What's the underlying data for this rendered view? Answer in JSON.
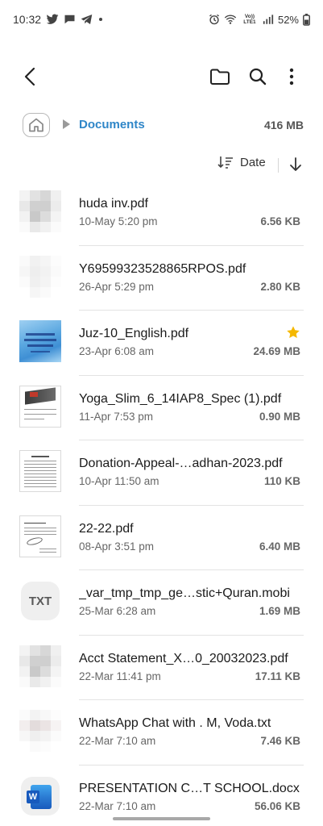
{
  "status_bar": {
    "time": "10:32",
    "net_label": "Vo)) LTE1",
    "battery": "52%"
  },
  "path": {
    "folder": "Documents",
    "storage": "416 MB"
  },
  "sort": {
    "label": "Date"
  },
  "files": [
    {
      "name": "huda inv.pdf",
      "date": "10-May 5:20 pm",
      "size": "6.56 KB",
      "thumb": "blur",
      "starred": false
    },
    {
      "name": "Y69599323528865RPOS.pdf",
      "date": "26-Apr 5:29 pm",
      "size": "2.80 KB",
      "thumb": "blur-light",
      "starred": false
    },
    {
      "name": "Juz-10_English.pdf",
      "date": "23-Apr 6:08 am",
      "size": "24.69 MB",
      "thumb": "sky",
      "starred": true
    },
    {
      "name": "Yoga_Slim_6_14IAP8_Spec (1).pdf",
      "date": "11-Apr 7:53 pm",
      "size": "0.90 MB",
      "thumb": "spec",
      "starred": false
    },
    {
      "name": "Donation-Appeal-…adhan-2023.pdf",
      "date": "10-Apr 11:50 am",
      "size": "110 KB",
      "thumb": "doc",
      "starred": false
    },
    {
      "name": "22-22.pdf",
      "date": "08-Apr 3:51 pm",
      "size": "6.40 MB",
      "thumb": "doc2",
      "starred": false
    },
    {
      "name": "_var_tmp_tmp_ge…stic+Quran.mobi",
      "date": "25-Mar 6:28 am",
      "size": "1.69 MB",
      "thumb": "txt",
      "starred": false
    },
    {
      "name": "Acct Statement_X…0_20032023.pdf",
      "date": "22-Mar 11:41 pm",
      "size": "17.11 KB",
      "thumb": "blur",
      "starred": false
    },
    {
      "name": "WhatsApp Chat with . M, Voda.txt",
      "date": "22-Mar 7:10 am",
      "size": "7.46 KB",
      "thumb": "blur-pink",
      "starred": false
    },
    {
      "name": "PRESENTATION C…T SCHOOL.docx",
      "date": "22-Mar 7:10 am",
      "size": "56.06 KB",
      "thumb": "word",
      "starred": false
    }
  ],
  "icons": {
    "txt_badge": "TXT",
    "word_letter": "W"
  },
  "colors": {
    "accent": "#2f86c8",
    "star": "#f5b800",
    "word": "#185abd"
  }
}
